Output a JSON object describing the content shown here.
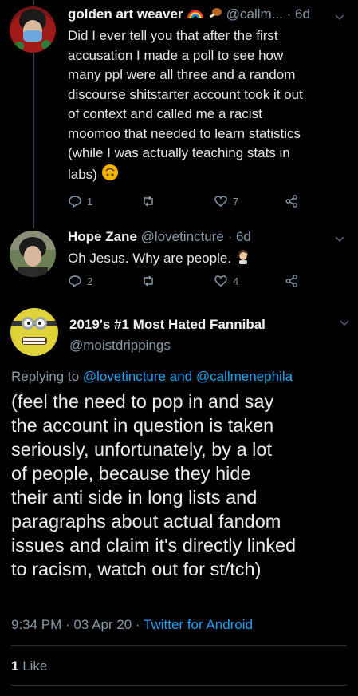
{
  "tweets": [
    {
      "name": "golden art weaver",
      "name_emojis": [
        "rainbow-emoji",
        "drumstick-emoji"
      ],
      "handle": "@callm...",
      "time": "· 6d",
      "text_lines": [
        "Did I ever tell you that after the first",
        "accusation I made a poll to see how",
        "many ppl were all three and a random",
        "discourse shitstarter account took it out",
        "of context and called me a racist",
        "moomoo that needed to learn statistics",
        "(while I was actually teaching stats in",
        "labs)"
      ],
      "trailing_emoji": "upside-down-face-emoji",
      "replies": "1",
      "retweets": "",
      "likes": "7"
    },
    {
      "name": "Hope Zane",
      "handle": "@lovetincture",
      "time": "· 6d",
      "text": "Oh Jesus. Why are people.",
      "trailing_emoji": "woman-facepalming-emoji",
      "replies": "2",
      "retweets": "",
      "likes": "4"
    }
  ],
  "focused": {
    "name": "2019's #1 Most Hated Fannibal",
    "handle": "@moistdrippings",
    "replying_prefix": "Replying to",
    "replying_to_1": "@lovetincture",
    "replying_and": "and",
    "replying_to_2": "@callmenephila",
    "text_lines": [
      "(feel the need to pop in and say",
      "the account in question is taken",
      "seriously, unfortunately, by a lot",
      "of people, because they hide",
      "their anti side in long lists and",
      "paragraphs about actual fandom",
      "issues and claim it's directly linked",
      "to racism, watch out for st/tch)"
    ],
    "time": "9:34 PM · 03 Apr 20 ·",
    "client": "Twitter for Android",
    "like_count": "1",
    "like_label": "Like"
  },
  "colors": {
    "accent": "#1da1f2",
    "muted": "#8b98a5",
    "background": "#000000"
  }
}
